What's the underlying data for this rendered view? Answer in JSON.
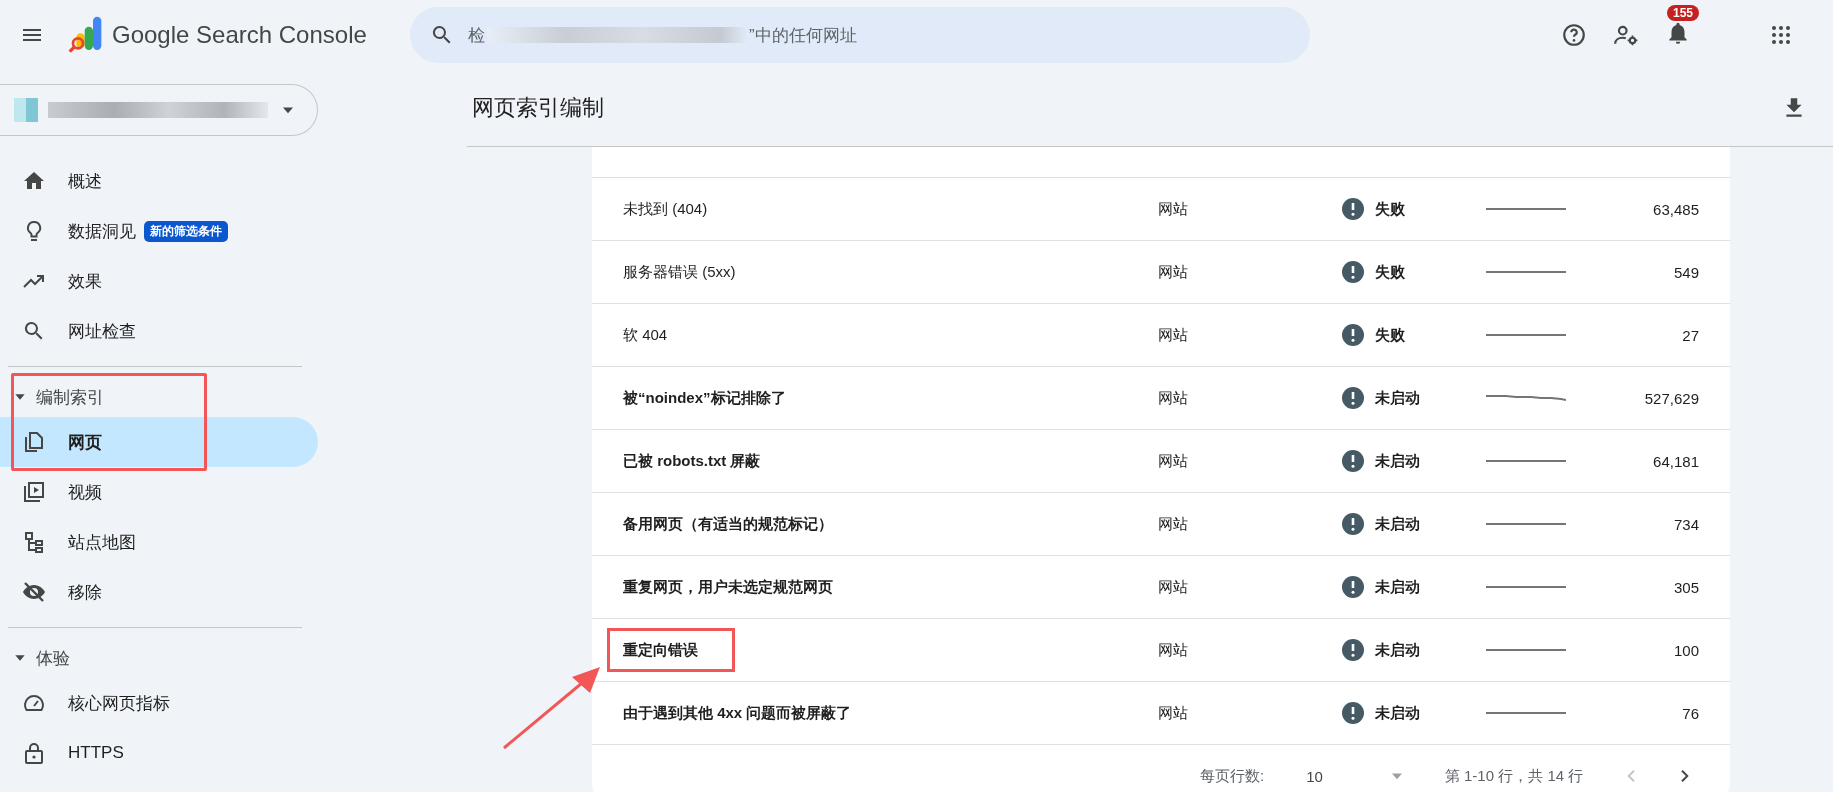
{
  "app": {
    "title": "Google Search Console"
  },
  "search": {
    "prefix": "检",
    "suffix": "”中的任何网址"
  },
  "toolbar": {
    "notification_count": "155"
  },
  "sidebar": {
    "items": [
      {
        "kind": "nav",
        "label": "概述",
        "selected": false
      },
      {
        "kind": "nav",
        "label": "数据洞见",
        "badge": "新的筛选条件",
        "selected": false
      },
      {
        "kind": "nav",
        "label": "效果",
        "selected": false
      },
      {
        "kind": "nav",
        "label": "网址检查",
        "selected": false
      },
      {
        "kind": "divider"
      },
      {
        "kind": "section",
        "label": "编制索引",
        "expanded": true,
        "annotated": true
      },
      {
        "kind": "nav",
        "label": "网页",
        "selected": true
      },
      {
        "kind": "nav",
        "label": "视频",
        "selected": false
      },
      {
        "kind": "nav",
        "label": "站点地图",
        "selected": false
      },
      {
        "kind": "nav",
        "label": "移除",
        "selected": false
      },
      {
        "kind": "divider"
      },
      {
        "kind": "section",
        "label": "体验",
        "expanded": true,
        "annotated": false
      },
      {
        "kind": "nav",
        "label": "核心网页指标",
        "selected": false
      },
      {
        "kind": "nav",
        "label": "HTTPS",
        "selected": false
      }
    ]
  },
  "page": {
    "title": "网页索引编制"
  },
  "table": {
    "rows": [
      {
        "reason": "未找到 (404)",
        "source": "网站",
        "status": "失败",
        "emphasized": false,
        "count": "63,485",
        "annotated": false
      },
      {
        "reason": "服务器错误 (5xx)",
        "source": "网站",
        "status": "失败",
        "emphasized": false,
        "count": "549",
        "annotated": false
      },
      {
        "reason": "软 404",
        "source": "网站",
        "status": "失败",
        "emphasized": false,
        "count": "27",
        "annotated": false
      },
      {
        "reason": "被“noindex”标记排除了",
        "source": "网站",
        "status": "未启动",
        "emphasized": true,
        "count": "527,629",
        "annotated": false
      },
      {
        "reason": "已被 robots.txt 屏蔽",
        "source": "网站",
        "status": "未启动",
        "emphasized": true,
        "count": "64,181",
        "annotated": false
      },
      {
        "reason": "备用网页（有适当的规范标记）",
        "source": "网站",
        "status": "未启动",
        "emphasized": true,
        "count": "734",
        "annotated": false
      },
      {
        "reason": "重复网页，用户未选定规范网页",
        "source": "网站",
        "status": "未启动",
        "emphasized": true,
        "count": "305",
        "annotated": false
      },
      {
        "reason": "重定向错误",
        "source": "网站",
        "status": "未启动",
        "emphasized": true,
        "count": "100",
        "annotated": true
      },
      {
        "reason": "由于遇到其他 4xx 问题而被屏蔽了",
        "source": "网站",
        "status": "未启动",
        "emphasized": true,
        "count": "76",
        "annotated": false
      }
    ],
    "pagination": {
      "rows_label": "每页行数:",
      "rows_per_page": "10",
      "range": "第 1-10 行，共 14 行",
      "prev_disabled": true,
      "next_disabled": false
    }
  }
}
